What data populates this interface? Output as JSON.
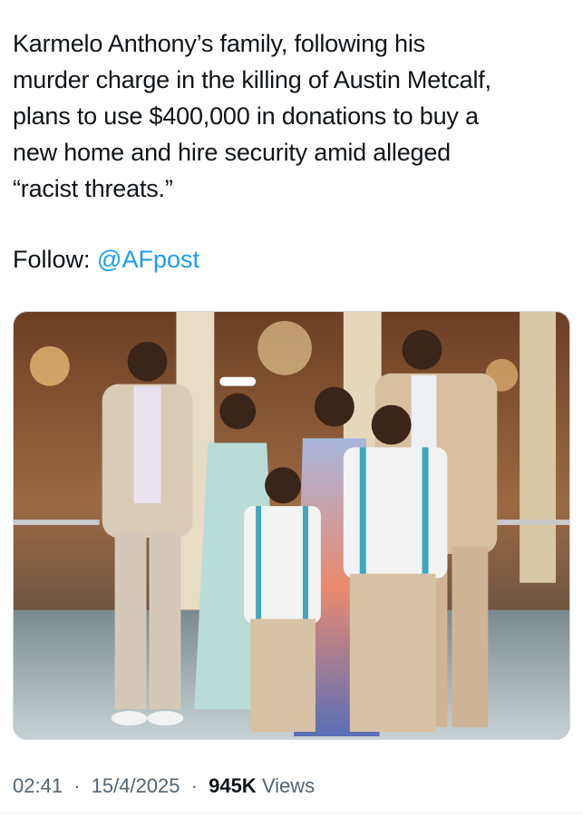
{
  "tweet": {
    "text": "Karmelo Anthony’s family, following his\nmurder charge in the killing of Austin Metcalf,\nplans to use $400,000 in donations to buy a\nnew home and hire security amid alleged\n“racist threats.”",
    "follow_label": "Follow:",
    "follow_handle": "@AFpost",
    "media": {
      "alt": "family photo"
    }
  },
  "meta": {
    "time": "02:41",
    "date": "15/4/2025",
    "separator": "·",
    "views_count": "945K",
    "views_label": "Views"
  },
  "colors": {
    "link": "#1d9bf0",
    "text": "#0f1419",
    "muted": "#536471"
  }
}
